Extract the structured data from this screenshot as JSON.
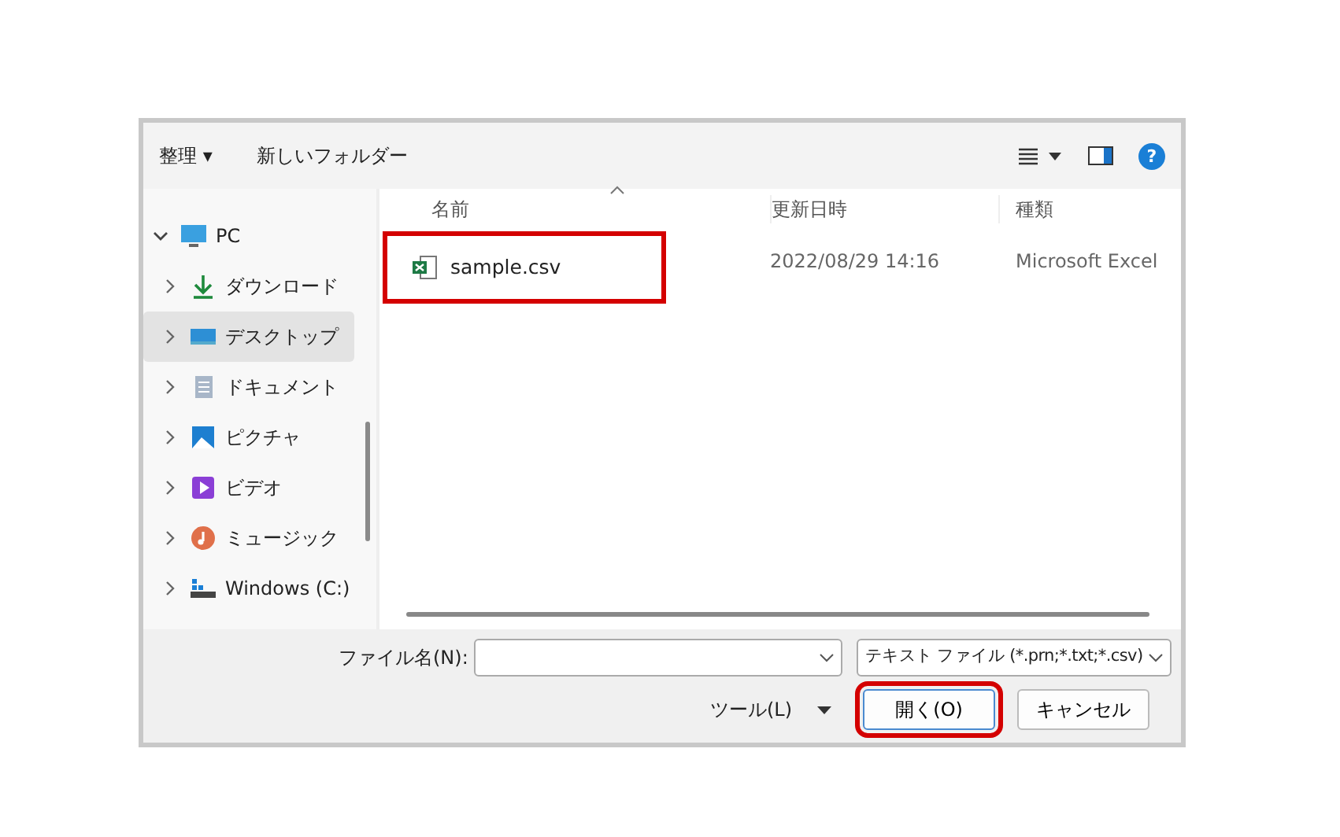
{
  "toolbar": {
    "organize": "整理 ▾",
    "new_folder": "新しいフォルダー",
    "help": "?"
  },
  "sidebar": {
    "items": [
      {
        "label": "PC",
        "kind": "pc",
        "expanded": true,
        "selected": false
      },
      {
        "label": "ダウンロード",
        "kind": "download",
        "expanded": false,
        "selected": false
      },
      {
        "label": "デスクトップ",
        "kind": "desktop",
        "expanded": false,
        "selected": true
      },
      {
        "label": "ドキュメント",
        "kind": "document",
        "expanded": false,
        "selected": false
      },
      {
        "label": "ピクチャ",
        "kind": "picture",
        "expanded": false,
        "selected": false
      },
      {
        "label": "ビデオ",
        "kind": "video",
        "expanded": false,
        "selected": false
      },
      {
        "label": "ミュージック",
        "kind": "music",
        "expanded": false,
        "selected": false
      },
      {
        "label": "Windows (C:)",
        "kind": "drive",
        "expanded": false,
        "selected": false
      }
    ]
  },
  "table": {
    "columns": [
      "名前",
      "更新日時",
      "種類"
    ],
    "rows": [
      {
        "name": "sample.csv",
        "modified": "2022/08/29 14:16",
        "type": "Microsoft Excel",
        "highlighted": true
      }
    ]
  },
  "footer": {
    "filename_label": "ファイル名(N):",
    "filetype": "テキスト ファイル (*.prn;*.txt;*.csv)",
    "tools": "ツール(L)",
    "buttons": [
      {
        "label": "開く(O)",
        "highlighted": true
      },
      {
        "label": "キャンセル",
        "highlighted": false
      }
    ]
  }
}
